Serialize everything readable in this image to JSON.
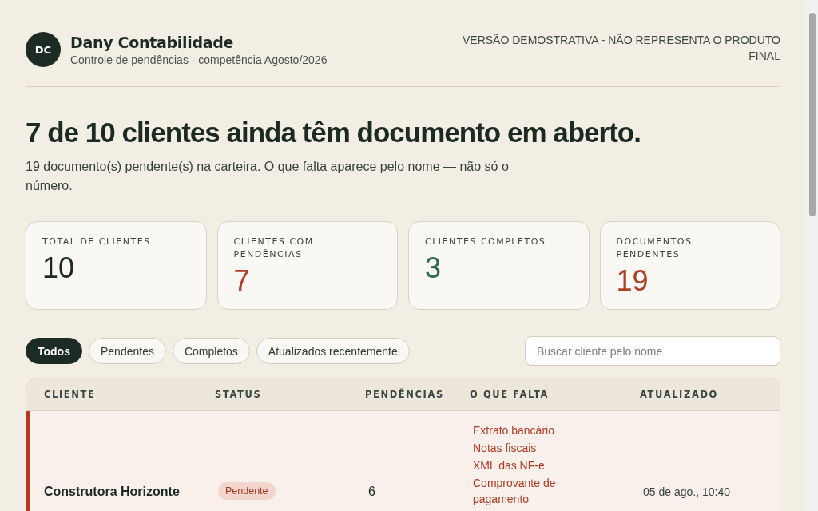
{
  "header": {
    "initials": "DC",
    "title": "Dany Contabilidade",
    "subtitle": "Controle de pendências · competência Agosto/2026",
    "notice": "VERSÃO DEMOSTRATIVA - NÃO REPRESENTA O PRODUTO FINAL"
  },
  "headline": "7 de 10 clientes ainda têm documento em aberto.",
  "summary": "19 documento(s) pendente(s) na carteira. O que falta aparece pelo nome — não só o número.",
  "stats": [
    {
      "label": "TOTAL DE CLIENTES",
      "value": "10",
      "kind": "neutral"
    },
    {
      "label": "CLIENTES COM PENDÊNCIAS",
      "value": "7",
      "kind": "alert"
    },
    {
      "label": "CLIENTES COMPLETOS",
      "value": "3",
      "kind": "ok"
    },
    {
      "label": "DOCUMENTOS PENDENTES",
      "value": "19",
      "kind": "alert"
    }
  ],
  "filters": [
    {
      "label": "Todos",
      "selected": true
    },
    {
      "label": "Pendentes",
      "selected": false
    },
    {
      "label": "Completos",
      "selected": false
    },
    {
      "label": "Atualizados recentemente",
      "selected": false
    }
  ],
  "search": {
    "placeholder": "Buscar cliente pelo nome"
  },
  "table": {
    "columns": [
      "CLIENTE",
      "STATUS",
      "PENDÊNCIAS",
      "O QUE FALTA",
      "ATUALIZADO"
    ],
    "rows": [
      {
        "client": "Construtora Horizonte",
        "status": "Pendente",
        "kind": "pending",
        "count": "6",
        "missing": [
          "Extrato bancário",
          "Notas fiscais",
          "XML das NF-e",
          "Comprovante de pagamento"
        ],
        "updated": "05 de ago., 10:40"
      }
    ]
  }
}
